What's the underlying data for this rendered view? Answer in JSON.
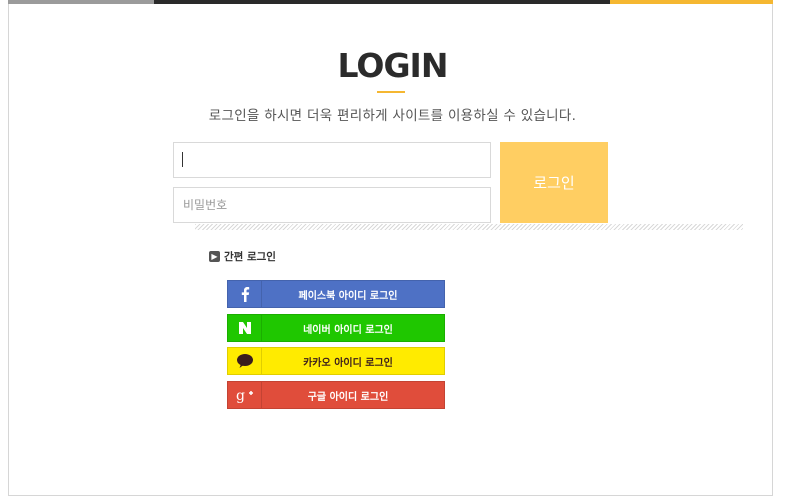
{
  "header": {
    "title": "LOGIN",
    "subtitle": "로그인을 하시면 더욱 편리하게 사이트를 이용하실 수 있습니다."
  },
  "form": {
    "id_value": "",
    "id_placeholder": "",
    "password_placeholder": "비밀번호",
    "login_button": "로그인"
  },
  "easy_login": {
    "label": "간편 로그인",
    "buttons": [
      {
        "label": "페이스북 아이디 로그인",
        "icon": "facebook-icon",
        "color": "#4e71c5"
      },
      {
        "label": "네이버 아이디 로그인",
        "icon": "naver-icon",
        "color": "#1fc700"
      },
      {
        "label": "카카오 아이디 로그인",
        "icon": "kakao-icon",
        "color": "#ffeb00"
      },
      {
        "label": "구글 아이디 로그인",
        "icon": "google-plus-icon",
        "color": "#e04d3b"
      }
    ]
  },
  "colors": {
    "accent": "#f5b731",
    "login_button": "#ffce62"
  }
}
